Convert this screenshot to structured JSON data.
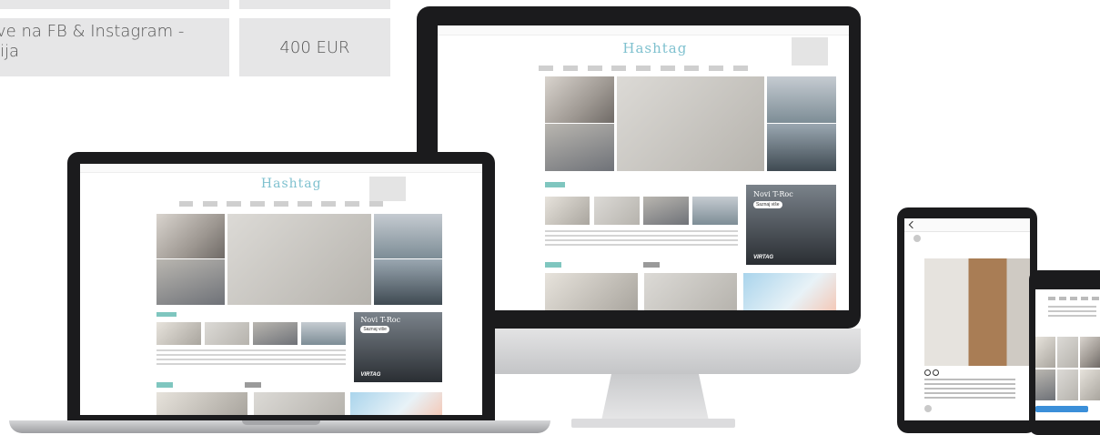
{
  "price_table": {
    "row_label": "ve na FB & Instagram -",
    "row_label_cont": "ija",
    "row_price": "400 EUR"
  },
  "website": {
    "logo": "Hashtag",
    "banner_title": "Novi T-Roc",
    "banner_button": "Saznaj više",
    "banner_brand": "VIRTAG"
  },
  "colors": {
    "accent": "#7fc1cf",
    "table_bg": "#e6e6e7",
    "device_dark": "#1b1b1d",
    "device_silver": "#c8c9cb"
  }
}
